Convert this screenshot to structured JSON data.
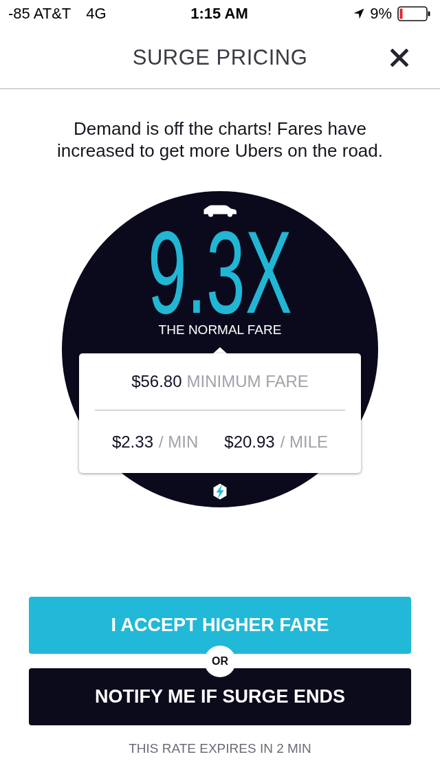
{
  "status_bar": {
    "carrier": "-85 AT&T",
    "network": "4G",
    "time": "1:15 AM",
    "battery": "9%"
  },
  "header": {
    "title": "SURGE PRICING"
  },
  "message": "Demand is off the charts! Fares have increased to get more Ubers on the road.",
  "surge": {
    "multiplier": "9.3X",
    "caption": "THE NORMAL FARE"
  },
  "fares": {
    "minimum": {
      "amount": "$56.80",
      "label": "MINIMUM FARE"
    },
    "rates": [
      {
        "amount": "$2.33",
        "unit": "/ MIN"
      },
      {
        "amount": "$20.93",
        "unit": "/ MILE"
      }
    ]
  },
  "actions": [
    {
      "kind": "primary",
      "label": "I ACCEPT HIGHER FARE"
    },
    {
      "kind": "secondary",
      "label": "NOTIFY ME IF SURGE ENDS"
    }
  ],
  "separator": "OR",
  "footer": "THIS RATE EXPIRES IN 2 MIN"
}
